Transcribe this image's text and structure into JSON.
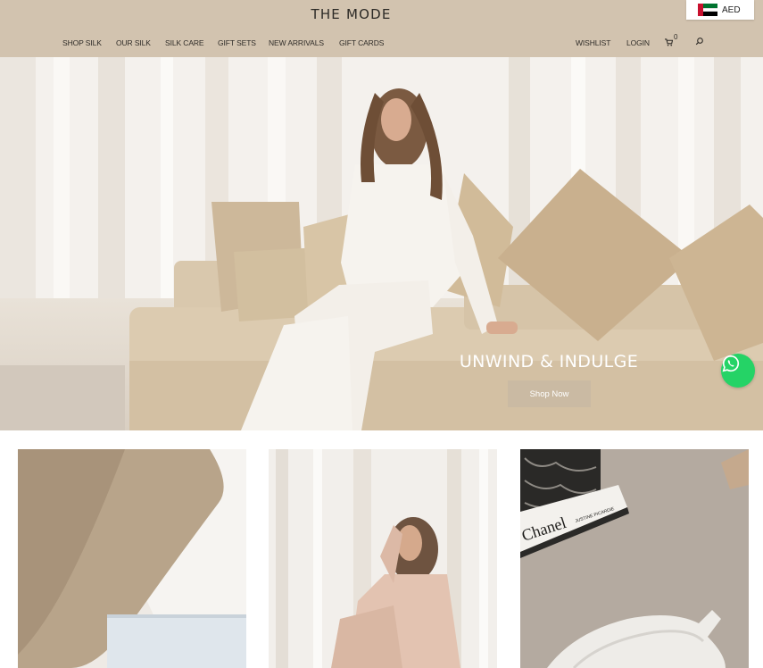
{
  "header": {
    "logo": "THE MODE",
    "currency": "AED",
    "nav_left": [
      "SHOP SILK",
      "OUR SILK",
      "SILK CARE",
      "GIFT SETS",
      "NEW ARRIVALS",
      "GIFT CARDS"
    ],
    "wishlist": "WISHLIST",
    "login": "LOGIN",
    "cart_count": "0"
  },
  "hero": {
    "headline": "UNWIND & INDULGE",
    "cta": "Shop Now"
  },
  "tiles": {
    "book_title": "Chanel",
    "book_author": "JUSTINE PICARDIE"
  },
  "colors": {
    "header_bg": "#d2c3af",
    "sofa": "#dccbb0",
    "pillow": "#cdb394",
    "whatsapp": "#25d366"
  },
  "icons": [
    "uae-flag-icon",
    "cart-icon",
    "search-icon",
    "whatsapp-icon"
  ]
}
